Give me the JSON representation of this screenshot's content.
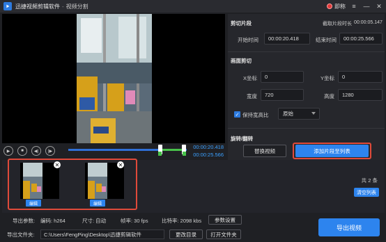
{
  "window": {
    "app_title": "迅捷视频剪辑软件",
    "separator": "-",
    "subtitle": "视频分割",
    "record_label": "即称"
  },
  "player": {
    "current_time": "00:00:20.418",
    "duration": "00:00:25.566",
    "progress_fraction": 0.8,
    "selection_start_fraction": 0.8,
    "selection_end_fraction": 1.0
  },
  "clip_section": {
    "title": "剪切片段",
    "duration_label": "截取片段时长",
    "duration_value": "00:00:05.147",
    "start_label": "开始时间",
    "start_value": "00:00:20.418",
    "end_label": "结束时间",
    "end_value": "00:00:25.566"
  },
  "crop_section": {
    "title": "画面剪切",
    "x_label": "X坐标",
    "x_value": "0",
    "y_label": "Y坐标",
    "y_value": "0",
    "width_label": "宽度",
    "width_value": "720",
    "height_label": "高度",
    "height_value": "1280",
    "keep_ratio_label": "保持宽高比",
    "keep_ratio_checked": true,
    "ratio_select": "原始"
  },
  "rotate_section": {
    "title": "旋转/翻转",
    "replace_button": "替换视频",
    "add_button": "添加片段至列表"
  },
  "clips": {
    "items": [
      {
        "edit_label": "编辑"
      },
      {
        "edit_label": "编辑"
      }
    ],
    "count_text": "共 2 条",
    "clear_button": "清空列表"
  },
  "export": {
    "params_label": "导出参数:",
    "codec": "编码: h264",
    "size": "尺寸: 自动",
    "fps": "帧率: 30 fps",
    "bitrate": "比特率: 2098 kbs",
    "param_settings_button": "参数设置",
    "folder_label": "导出文件夹:",
    "folder_path": "C:\\Users\\FengPing\\Desktop\\迅捷剪辑软件",
    "change_dir_button": "更改目录",
    "open_folder_button": "打开文件夹",
    "export_button": "导出视频"
  },
  "colors": {
    "accent": "#2d84ee",
    "highlight_border": "#e04a3a",
    "time_text": "#3aa0ff",
    "selection": "#48c24a"
  }
}
